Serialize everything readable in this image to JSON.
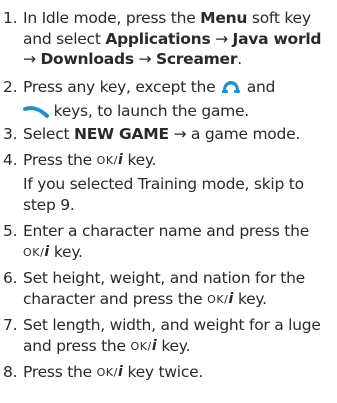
{
  "steps": [
    {
      "num": "1.",
      "t1": "In Idle mode, press the ",
      "b1": "Menu",
      "t2": " soft key and select ",
      "b2": "Applications",
      "arrow": "→",
      "b3": "Java world",
      "b4": "Downloads",
      "b5": "Screamer",
      "t3": "."
    },
    {
      "num": "2.",
      "t1": "Press any key, except the ",
      "t2": " and",
      "t3": " keys, to launch the game."
    },
    {
      "num": "3.",
      "t1": "Select ",
      "b1": "NEW GAME",
      "t2": " → a game mode."
    },
    {
      "num": "4.",
      "t1": "Press the ",
      "t2": " key."
    },
    {
      "num": "5.",
      "t1": "Enter a character name and press the ",
      "t2": " key."
    },
    {
      "num": "6.",
      "t1": "Set height, weight, and nation for the character and press the ",
      "t2": " key."
    },
    {
      "num": "7.",
      "t1": "Set length, width, and weight for a luge and press the ",
      "t2": " key."
    },
    {
      "num": "8.",
      "t1": "Press the ",
      "t2": " key twice."
    }
  ],
  "note": "If you selected Training mode, skip to step 9.",
  "ok_key": {
    "ok": "OK/",
    "i": "i"
  },
  "icons": {
    "send": "call-send-key-icon",
    "end": "end-key-icon"
  },
  "colors": {
    "text": "#2a2a2a",
    "send_key": "#1f8fd0",
    "end_key": "#1f8fd0"
  }
}
